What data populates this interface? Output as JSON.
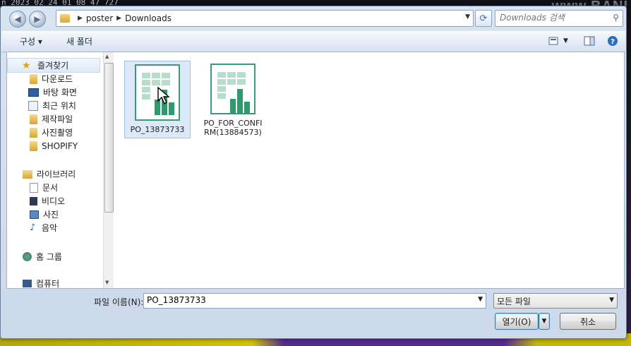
{
  "background": {
    "timestamp_text": "n 2023 02 24 01 08 47 727",
    "brand_text": "www.BANI"
  },
  "navigation": {
    "back_icon": "back-arrow-icon",
    "forward_icon": "forward-arrow-icon",
    "breadcrumbs": [
      "poster",
      "Downloads"
    ],
    "search_placeholder": "Downloads 검색"
  },
  "toolbar": {
    "organize_label": "구성 ▾",
    "new_folder_label": "새 폴더"
  },
  "sidebar": {
    "favorites_header": "즐겨찾기",
    "favorites": [
      "다운로드",
      "바탕 화면",
      "최근 위치",
      "제작파일",
      "사진촬영",
      "SHOPIFY"
    ],
    "libraries_header": "라이브러리",
    "libraries": [
      "문서",
      "비디오",
      "사진",
      "음악"
    ],
    "homegroup": "홈 그룹",
    "computer": "컴퓨터"
  },
  "files": [
    {
      "name": "PO_13873733",
      "selected": true
    },
    {
      "name": "PO_FOR_CONFIRM(13884573)",
      "selected": false
    }
  ],
  "footer": {
    "filename_label": "파일 이름(N):",
    "filename_value": "PO_13873733",
    "filetype_value": "모든 파일",
    "open_label": "열기(O)",
    "cancel_label": "취소"
  },
  "colors": {
    "accent_green": "#2f9a6c",
    "selection": "#dbe9f9"
  }
}
